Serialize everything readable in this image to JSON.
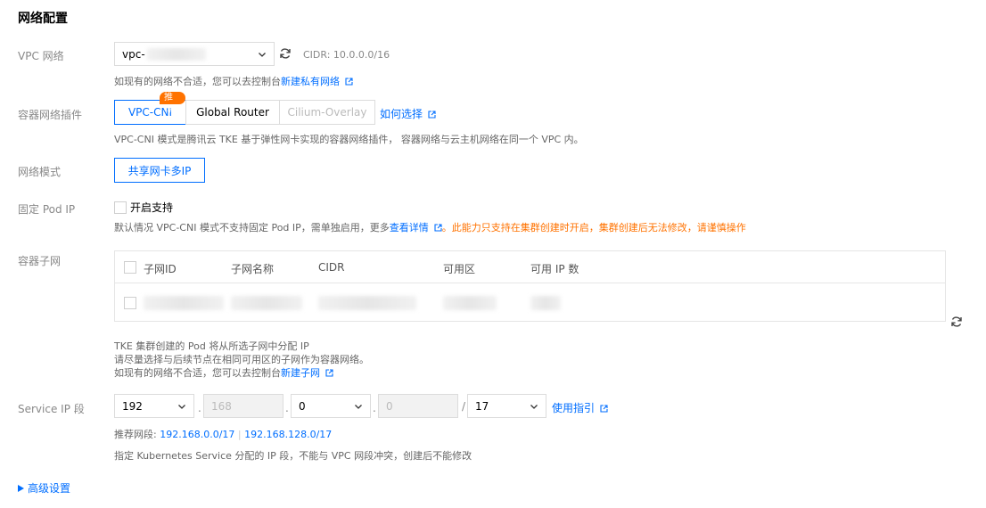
{
  "section_title": "网络配置",
  "vpc": {
    "label": "VPC 网络",
    "select_value": "vpc-",
    "cidr_text": "CIDR: 10.0.0.0/16",
    "hint_prefix": "如现有的网络不合适，您可以去控制台",
    "hint_link": "新建私有网络"
  },
  "plugin": {
    "label": "容器网络插件",
    "options": [
      "VPC-CNI",
      "Global Router",
      "Cilium-Overlay"
    ],
    "badge": "推荐",
    "help_link": "如何选择",
    "description": "VPC-CNI 模式是腾讯云 TKE 基于弹性网卡实现的容器网络插件， 容器网络与云主机网络在同一个 VPC 内。"
  },
  "mode": {
    "label": "网络模式",
    "value": "共享网卡多IP"
  },
  "fixed_ip": {
    "label": "固定 Pod IP",
    "checkbox_label": "开启支持",
    "hint_prefix": "默认情况 VPC-CNI 模式不支持固定 Pod IP，需单独启用，更多",
    "hint_link": "查看详情",
    "warning": "。此能力只支持在集群创建时开启，集群创建后无法修改，请谨慎操作"
  },
  "subnet": {
    "label": "容器子网",
    "columns": [
      "子网ID",
      "子网名称",
      "CIDR",
      "可用区",
      "可用 IP 数"
    ],
    "hint_line1": "TKE 集群创建的 Pod 将从所选子网中分配 IP",
    "hint_line2": "请尽量选择与后续节点在相同可用区的子网作为容器网络。",
    "hint_line3_prefix": "如现有的网络不合适，您可以去控制台",
    "hint_line3_link": "新建子网"
  },
  "service_ip": {
    "label": "Service IP 段",
    "octet1": "192",
    "octet2": "168",
    "octet3": "0",
    "octet4": "0",
    "mask": "17",
    "separator_dot": ".",
    "separator_slash": "/",
    "guide_link": "使用指引",
    "recommend_prefix": "推荐网段:",
    "recommend_1": "192.168.0.0/17",
    "recommend_sep": "|",
    "recommend_2": "192.168.128.0/17",
    "description": "指定 Kubernetes Service 分配的 IP 段，不能与 VPC 网段冲突，创建后不能修改"
  },
  "advanced": {
    "label": "高级设置"
  },
  "colors": {
    "accent": "#006eff",
    "warning": "#ff7200",
    "border": "#dcdcdc"
  }
}
